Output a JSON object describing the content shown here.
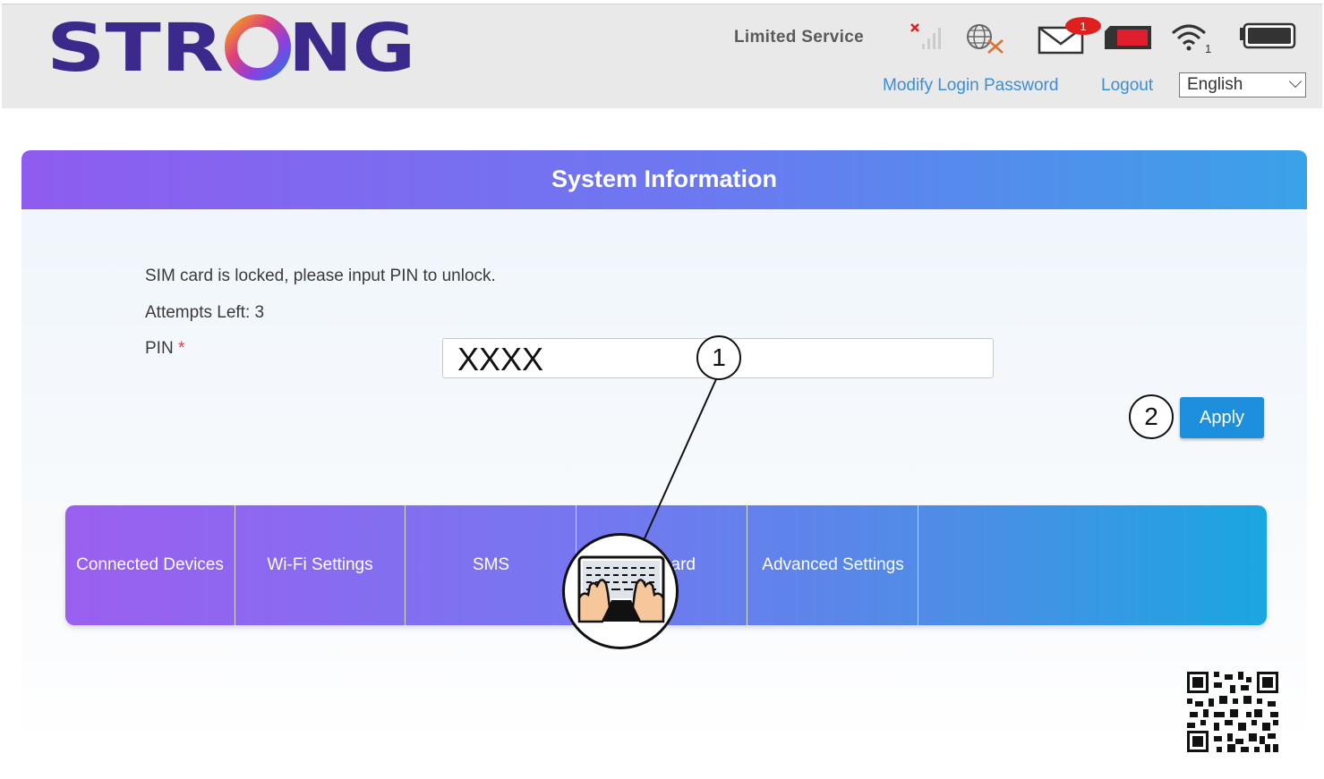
{
  "header": {
    "brand": "STRONG",
    "status_text": "Limited Service",
    "mail_badge": "1",
    "wifi_count": "1",
    "links": {
      "modify_password": "Modify Login Password",
      "logout": "Logout"
    },
    "language": "English",
    "icons": [
      "no-signal-icon",
      "globe-disconnected-icon",
      "mail-icon",
      "sim-card-icon",
      "wifi-icon",
      "battery-icon"
    ]
  },
  "panel": {
    "title": "System Information",
    "message": "SIM card is locked, please input PIN to unlock.",
    "attempts": "Attempts Left: 3",
    "pin_label": "PIN",
    "required_mark": "*",
    "pin_value": "XXXX",
    "apply_label": "Apply"
  },
  "callouts": [
    "1",
    "2"
  ],
  "nav": [
    "Connected Devices",
    "Wi-Fi Settings",
    "SMS",
    "ard",
    "Advanced Settings"
  ],
  "colors": {
    "brand_purple": "#3b2a8c",
    "accent_blue": "#1e8fdc",
    "link_blue": "#3b8ed6",
    "alert_red": "#e02020"
  }
}
